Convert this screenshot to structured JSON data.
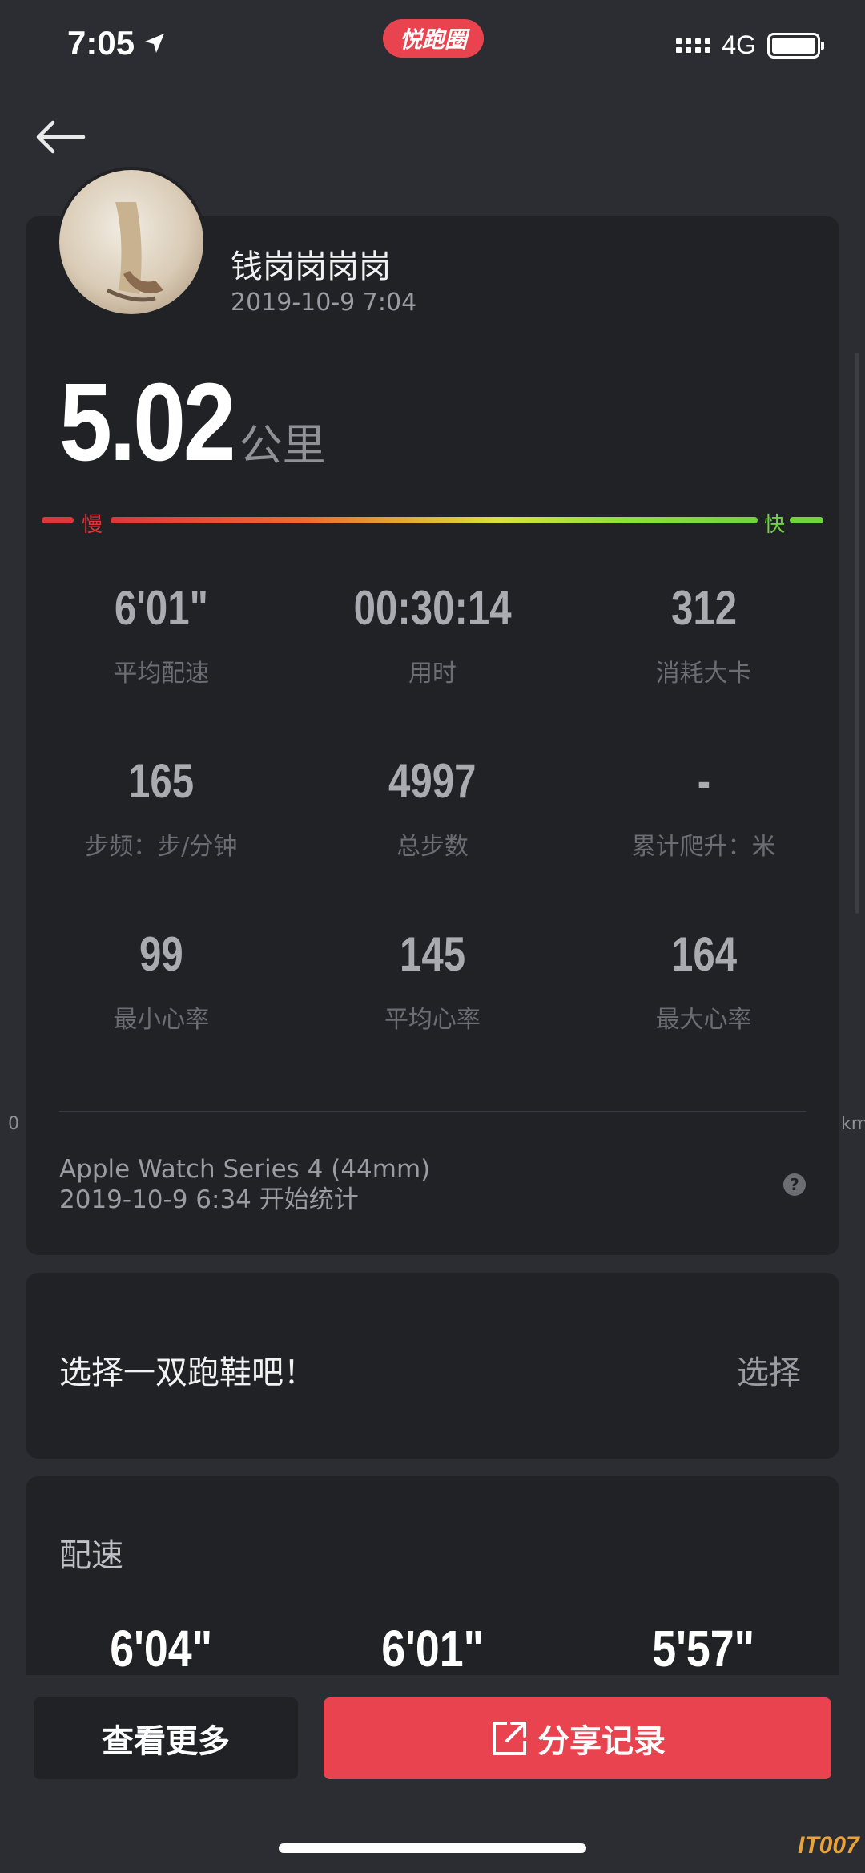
{
  "status_bar": {
    "time": "7:05",
    "app_badge": "悦跑圈",
    "network": "4G"
  },
  "header": {
    "back_icon": "arrow-left-icon"
  },
  "run": {
    "user_name": "钱岗岗岗岗",
    "date": "2019-10-9 7:04",
    "distance": "5.02",
    "distance_unit": "公里",
    "pace_scale": {
      "slow_label": "慢",
      "fast_label": "快"
    }
  },
  "stats": [
    [
      {
        "value": "6'01\"",
        "label": "平均配速"
      },
      {
        "value": "00:30:14",
        "label": "用时"
      },
      {
        "value": "312",
        "label": "消耗大卡"
      }
    ],
    [
      {
        "value": "165",
        "label": "步频：步/分钟"
      },
      {
        "value": "4997",
        "label": "总步数"
      },
      {
        "value": "-",
        "label": "累计爬升：米"
      }
    ],
    [
      {
        "value": "99",
        "label": "最小心率"
      },
      {
        "value": "145",
        "label": "平均心率"
      },
      {
        "value": "164",
        "label": "最大心率"
      }
    ]
  ],
  "device": {
    "name": "Apple Watch Series 4 (44mm)",
    "start": "2019-10-9 6:34 开始统计",
    "help": "?"
  },
  "edges": {
    "left": "0",
    "right": "km"
  },
  "shoe": {
    "prompt": "选择一双跑鞋吧！",
    "action": "选择"
  },
  "pace_section": {
    "title": "配速",
    "values": [
      "6'04\"",
      "6'01\"",
      "5'57\""
    ]
  },
  "bottom": {
    "more": "查看更多",
    "share": "分享记录"
  },
  "watermark": "IT007",
  "colors": {
    "accent": "#e8434f",
    "background": "#2b2d33",
    "card": "#202226",
    "slow": "#e0363b",
    "fast": "#6fd53b"
  }
}
